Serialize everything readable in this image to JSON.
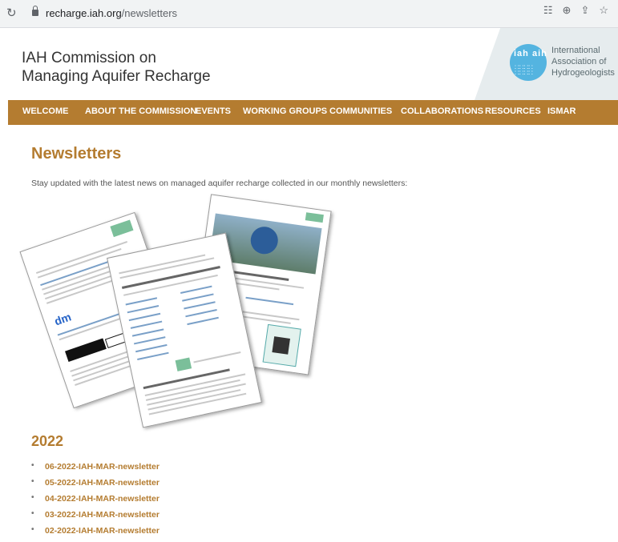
{
  "browser": {
    "url_domain": "recharge.iah.org",
    "url_path": "/newsletters"
  },
  "header": {
    "title_line1": "IAH Commission on",
    "title_line2": "Managing Aquifer Recharge",
    "logo_text": "iah aih",
    "org_line1": "International",
    "org_line2": "Association of",
    "org_line3": "Hydrogeologists"
  },
  "nav": {
    "items": [
      {
        "label": "WELCOME"
      },
      {
        "label": "ABOUT THE COMMISSION"
      },
      {
        "label": "EVENTS"
      },
      {
        "label": "WORKING GROUPS"
      },
      {
        "label": "COMMUNITIES"
      },
      {
        "label": "COLLABORATIONS"
      },
      {
        "label": "RESOURCES"
      },
      {
        "label": "ISMAR"
      }
    ]
  },
  "main": {
    "title": "Newsletters",
    "intro": "Stay updated with the latest news on managed aquifer recharge collected in our monthly newsletters:",
    "year": "2022",
    "newsletters": [
      {
        "label": "06-2022-IAH-MAR-newsletter"
      },
      {
        "label": "05-2022-IAH-MAR-newsletter"
      },
      {
        "label": "04-2022-IAH-MAR-newsletter"
      },
      {
        "label": "03-2022-IAH-MAR-newsletter"
      },
      {
        "label": "02-2022-IAH-MAR-newsletter"
      }
    ]
  },
  "colors": {
    "accent": "#b47c30",
    "nav_bg": "#b47c30",
    "logo_blue": "#54b4e0"
  }
}
